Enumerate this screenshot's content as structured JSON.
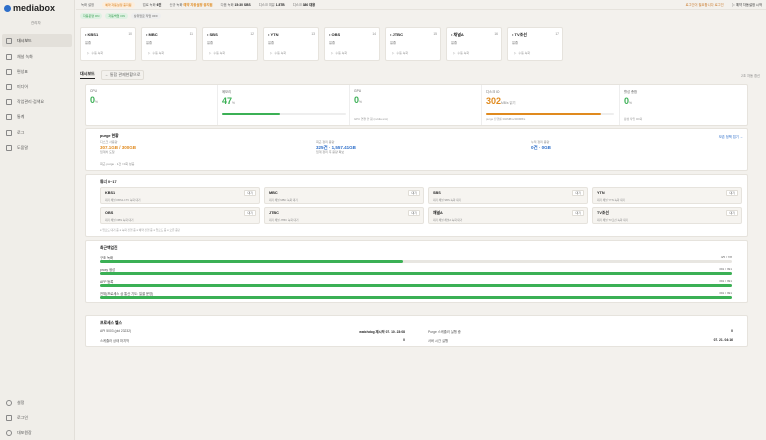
{
  "brand": {
    "name": "mediabox",
    "role": "관리자"
  },
  "sidebar": {
    "items": [
      {
        "label": "대시보드",
        "icon": "dashboard-icon",
        "active": true
      },
      {
        "label": "채널 녹화",
        "icon": "record-icon"
      },
      {
        "label": "편성표",
        "icon": "schedule-icon"
      },
      {
        "label": "미디어",
        "icon": "media-icon"
      },
      {
        "label": "작업관리·검색요",
        "icon": "task-icon"
      },
      {
        "label": "통계",
        "icon": "stats-icon"
      },
      {
        "label": "로그",
        "icon": "log-icon"
      },
      {
        "label": "도움말",
        "icon": "help-icon"
      }
    ],
    "bottom": [
      {
        "label": "설정",
        "icon": "gear-icon"
      },
      {
        "label": "로그인",
        "icon": "login-icon"
      },
      {
        "label": "대포원장",
        "icon": "power-icon"
      }
    ]
  },
  "topbar": {
    "label1": "녹화 설정",
    "pill1": "예약 자동설정 중지됨",
    "label2": "업로 녹화",
    "value2": "6건",
    "label3": "신규 녹화",
    "value3": "예약 자동설정 중지됨",
    "label4": "다음 녹화",
    "value4": "15:30 SBS",
    "label5": "디스크 여유",
    "value5": "1.8TB",
    "label6": "디스크",
    "value6": "380 대용",
    "warn": "로그인이 필요합니다 로그인",
    "right": "예약 자동설정 시작"
  },
  "chips": [
    "자동운영 ON",
    "자동백업 ON",
    "상위업로 작업 OFF"
  ],
  "channels": [
    {
      "name": "KBS1",
      "num": "10",
      "status": "유휴",
      "button": "수동 녹화"
    },
    {
      "name": "MBC",
      "num": "11",
      "status": "유휴",
      "button": "수동 녹화"
    },
    {
      "name": "SBS",
      "num": "12",
      "status": "유휴",
      "button": "수동 녹화"
    },
    {
      "name": "YTN",
      "num": "13",
      "status": "유휴",
      "button": "수동 녹화"
    },
    {
      "name": "OBS",
      "num": "14",
      "status": "유휴",
      "button": "수동 녹화"
    },
    {
      "name": "JTBC",
      "num": "15",
      "status": "유휴",
      "button": "수동 녹화"
    },
    {
      "name": "채널A",
      "num": "16",
      "status": "유휴",
      "button": "수동 녹화"
    },
    {
      "name": "TV조선",
      "num": "17",
      "status": "유휴",
      "button": "수동 녹화"
    }
  ],
  "tabs": {
    "active": "대시보드",
    "back": "← 통합 관제현황으로",
    "right": "2초 자동 갱신"
  },
  "metrics": [
    {
      "label": "CPU",
      "value": "0",
      "unit": "%",
      "color": "green",
      "fill": 0,
      "sub": ""
    },
    {
      "label": "메모리",
      "value": "47",
      "unit": "%",
      "color": "green",
      "fill": 47,
      "sub": ""
    },
    {
      "label": "GPU",
      "value": "0",
      "unit": "%",
      "color": "green",
      "fill": 0,
      "sub": "GPU 연결 안 됨 (nvidia-smi)"
    },
    {
      "label": "디스크 IO",
      "value": "302",
      "unit": "MB/s 읽기",
      "color": "orange",
      "fill": 90,
      "sub": "purge 진행률 302MB/s/400MB/s"
    },
    {
      "label": "활성 총합",
      "value": "0",
      "unit": "%",
      "color": "green",
      "fill": 0,
      "sub": "활성 작업 0/0회"
    }
  ],
  "purge": {
    "title": "purge 현황",
    "link": "보존 정책 접기 →",
    "c1_label": "디스크 사용량",
    "c1_value": "307.1GB / 300GB",
    "c1_sub": "임계치 도달",
    "c2_label": "최근 정리 용량",
    "c2_value": "325건 · 1,557.41GB",
    "c2_sub": "임계 정리 후 용량 확보",
    "c3_label": "누적 정리 용량",
    "c3_value": "0건 · 0GB",
    "note": "최근 purge · 1건 / 0회 성공"
  },
  "channel_status": {
    "title": "튜너 0~17",
    "items": [
      {
        "name": "KBS1",
        "badge": "대기",
        "l1": "대기 채널 KBS1-1TV 녹화 대기",
        "l2": ""
      },
      {
        "name": "MBC",
        "badge": "대기",
        "l1": "대기 채널 MBC 녹화 대기",
        "l2": ""
      },
      {
        "name": "SBS",
        "badge": "대기",
        "l1": "대기 채널 SBS 녹화 대기",
        "l2": ""
      },
      {
        "name": "YTN",
        "badge": "대기",
        "l1": "대기 채널 YTN 녹화 대기",
        "l2": ""
      },
      {
        "name": "OBS",
        "badge": "대기",
        "l1": "대기 채널 OBS 녹화 대기",
        "l2": ""
      },
      {
        "name": "JTBC",
        "badge": "대기",
        "l1": "대기 채널 JTBC 녹화 대기",
        "l2": ""
      },
      {
        "name": "채널A",
        "badge": "대기",
        "l1": "대기 채널 채널A 녹화 대기",
        "l2": ""
      },
      {
        "name": "TV조선",
        "badge": "대기",
        "l1": "대기 채널 TV조선 녹화 대기",
        "l2": ""
      }
    ],
    "footnote": "● 업로드 대기 중 ● 녹화 진행 중 ● 예약 진행 중 ● 업로드 중 ● 오류 중단"
  },
  "recent": {
    "title": "최근백업진",
    "rows": [
      {
        "label": "구조 녹화",
        "value": "4/5 / 7/8",
        "fill": 0.48
      },
      {
        "label": "proxy 생성",
        "value": "391 / 391",
        "fill": 1.0
      },
      {
        "label": "AFP 등록",
        "value": "391 / 391",
        "fill": 1.0
      },
      {
        "label": "전체(프로세스 상 통산 기도: 일괄 운영)",
        "value": "391 / 391",
        "fill": 1.0
      }
    ]
  },
  "process": {
    "title": "프로세스 헬스",
    "left": [
      {
        "label": "API 5003 (pid 23232)",
        "value": "watchdog 재시작 07. 10. 23:08"
      },
      {
        "label": "스케줄러 상태 마지막",
        "value": "0"
      }
    ],
    "right": [
      {
        "label": "Purge 스케줄러 실행 중",
        "value": "0"
      },
      {
        "label": "서버 시간 실행",
        "value": "07. 21. 04:16"
      }
    ]
  },
  "colors": {
    "green": "#3bb055",
    "orange": "#e08a1e",
    "blue": "#2d6ec9"
  }
}
